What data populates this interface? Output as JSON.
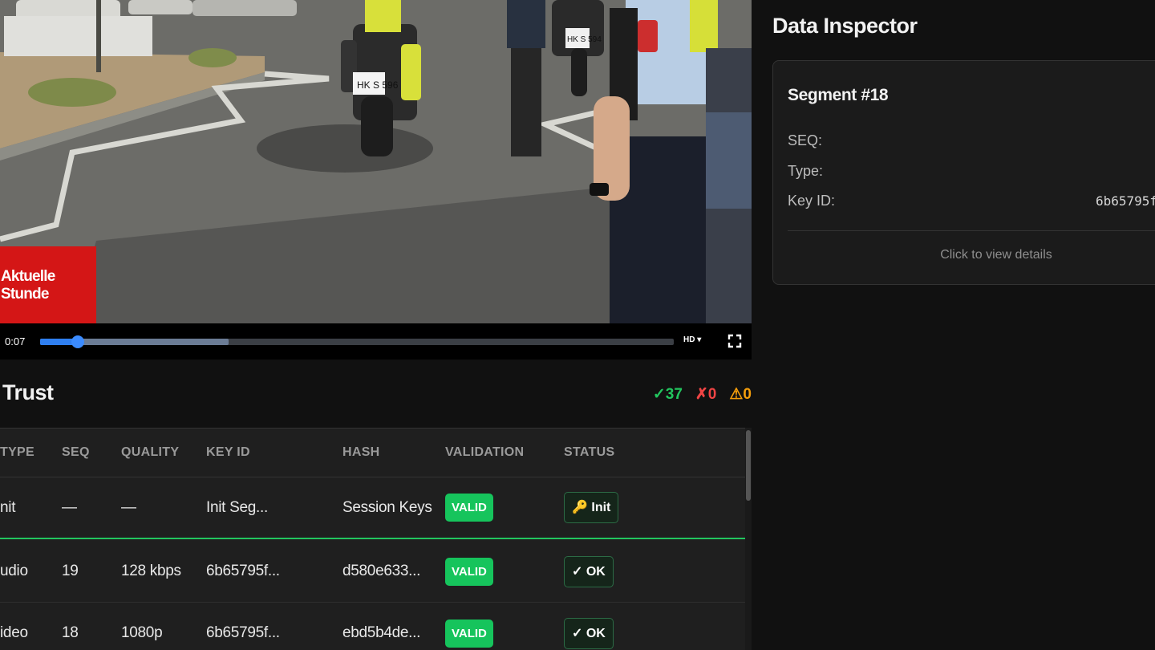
{
  "video": {
    "ticker_text": "Aktuelle Stunde",
    "time": "0:07",
    "played_fraction": 0.06,
    "buffered_fraction": 0.298,
    "quality": "HD ▾",
    "plate_1": "HK S 596",
    "plate_2": "HK S 594"
  },
  "trust": {
    "title": "Trust",
    "count_ok": "✓37",
    "count_err": "✗0",
    "count_warn": "⚠0",
    "columns": [
      "TYPE",
      "SEQ",
      "QUALITY",
      "KEY ID",
      "HASH",
      "VALIDATION",
      "STATUS"
    ],
    "rows": [
      {
        "type": "nit",
        "seq": "—",
        "quality": "—",
        "key_id": "Init Seg...",
        "hash": "Session Keys",
        "validation": "VALID",
        "status": "🔑 Init"
      },
      {
        "type": "udio",
        "seq": "19",
        "quality": "128 kbps",
        "key_id": "6b65795f...",
        "hash": "d580e633...",
        "validation": "VALID",
        "status": "✓ OK"
      },
      {
        "type": "ideo",
        "seq": "18",
        "quality": "1080p",
        "key_id": "6b65795f...",
        "hash": "ebd5b4de...",
        "validation": "VALID",
        "status": "✓ OK"
      }
    ]
  },
  "inspector": {
    "title": "Data Inspector",
    "segment_title": "Segment #18",
    "seq_label": "SEQ:",
    "type_label": "Type:",
    "key_label": "Key ID:",
    "key_value": "6b65795f",
    "link": "Click to view details"
  },
  "colors": {
    "valid_green": "#16c45c",
    "error_red": "#ef4444",
    "warn_amber": "#f59e0b",
    "progress_blue": "#2f7ff0",
    "ticker_red": "#d41616"
  }
}
